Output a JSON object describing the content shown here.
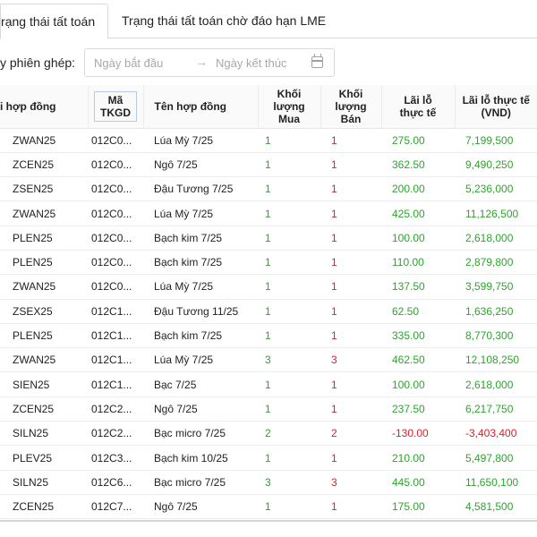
{
  "tabs": [
    {
      "label": "Trạng thái tất toán",
      "active": true
    },
    {
      "label": "Trạng thái tất toán chờ đáo hạn LME",
      "active": false
    }
  ],
  "filter": {
    "label": "y phiên ghép:",
    "start_placeholder": "Ngày bắt đầu",
    "end_placeholder": "Ngày kết thúc"
  },
  "table": {
    "headers": {
      "hop_dong": "i hợp đồng",
      "ma_line1": "Mã",
      "ma_line2": "TKGD",
      "ten_hop_dong": "Tên hợp đồng",
      "kl_mua_line1": "Khối",
      "kl_mua_line2": "lượng",
      "kl_mua_line3": "Mua",
      "kl_ban_line1": "Khối",
      "kl_ban_line2": "lượng",
      "kl_ban_line3": "Bán",
      "lai_lo_line1": "Lãi lỗ",
      "lai_lo_line2": "thực tế",
      "lai_lo_vnd_line1": "Lãi lỗ thực tế",
      "lai_lo_vnd_line2": "(VND)"
    },
    "rows": [
      {
        "hop_dong": "ZWAN25",
        "ma": "012C0...",
        "ten": "Lúa Mỳ 7/25",
        "mua": "1",
        "ban": "1",
        "lai_lo": "275.00",
        "vnd": "7,199,500"
      },
      {
        "hop_dong": "ZCEN25",
        "ma": "012C0...",
        "ten": "Ngô 7/25",
        "mua": "1",
        "ban": "1",
        "lai_lo": "362.50",
        "vnd": "9,490,250"
      },
      {
        "hop_dong": "ZSEN25",
        "ma": "012C0...",
        "ten": "Đậu Tương 7/25",
        "mua": "1",
        "ban": "1",
        "lai_lo": "200.00",
        "vnd": "5,236,000"
      },
      {
        "hop_dong": "ZWAN25",
        "ma": "012C0...",
        "ten": "Lúa Mỳ 7/25",
        "mua": "1",
        "ban": "1",
        "lai_lo": "425.00",
        "vnd": "11,126,500"
      },
      {
        "hop_dong": "PLEN25",
        "ma": "012C0...",
        "ten": "Bạch kim 7/25",
        "mua": "1",
        "ban": "1",
        "lai_lo": "100.00",
        "vnd": "2,618,000"
      },
      {
        "hop_dong": "PLEN25",
        "ma": "012C0...",
        "ten": "Bạch kim 7/25",
        "mua": "1",
        "ban": "1",
        "lai_lo": "110.00",
        "vnd": "2,879,800"
      },
      {
        "hop_dong": "ZWAN25",
        "ma": "012C0...",
        "ten": "Lúa Mỳ 7/25",
        "mua": "1",
        "ban": "1",
        "lai_lo": "137.50",
        "vnd": "3,599,750"
      },
      {
        "hop_dong": "ZSEX25",
        "ma": "012C1...",
        "ten": "Đậu Tương 11/25",
        "mua": "1",
        "ban": "1",
        "lai_lo": "62.50",
        "vnd": "1,636,250"
      },
      {
        "hop_dong": "PLEN25",
        "ma": "012C1...",
        "ten": "Bạch kim 7/25",
        "mua": "1",
        "ban": "1",
        "lai_lo": "335.00",
        "vnd": "8,770,300"
      },
      {
        "hop_dong": "ZWAN25",
        "ma": "012C1...",
        "ten": "Lúa Mỳ 7/25",
        "mua": "3",
        "ban": "3",
        "lai_lo": "462.50",
        "vnd": "12,108,250"
      },
      {
        "hop_dong": "SIEN25",
        "ma": "012C1...",
        "ten": "Bạc 7/25",
        "mua": "1",
        "ban": "1",
        "lai_lo": "100.00",
        "vnd": "2,618,000"
      },
      {
        "hop_dong": "ZCEN25",
        "ma": "012C2...",
        "ten": "Ngô 7/25",
        "mua": "1",
        "ban": "1",
        "lai_lo": "237.50",
        "vnd": "6,217,750"
      },
      {
        "hop_dong": "SILN25",
        "ma": "012C2...",
        "ten": "Bạc micro 7/25",
        "mua": "2",
        "ban": "2",
        "lai_lo": "-130.00",
        "vnd": "-3,403,400"
      },
      {
        "hop_dong": "PLEV25",
        "ma": "012C3...",
        "ten": "Bạch kim 10/25",
        "mua": "1",
        "ban": "1",
        "lai_lo": "210.00",
        "vnd": "5,497,800"
      },
      {
        "hop_dong": "SILN25",
        "ma": "012C6...",
        "ten": "Bạc micro 7/25",
        "mua": "3",
        "ban": "3",
        "lai_lo": "445.00",
        "vnd": "11,650,100"
      },
      {
        "hop_dong": "ZCEN25",
        "ma": "012C7...",
        "ten": "Ngô 7/25",
        "mua": "1",
        "ban": "1",
        "lai_lo": "175.00",
        "vnd": "4,581,500"
      }
    ]
  },
  "colors": {
    "buy": "#2ca52c",
    "sell": "#e0202a",
    "profit": "#2ca52c",
    "loss": "#e0202a"
  },
  "icons": {
    "range_separator": "arrow-right-icon",
    "date_picker": "calendar-icon"
  }
}
